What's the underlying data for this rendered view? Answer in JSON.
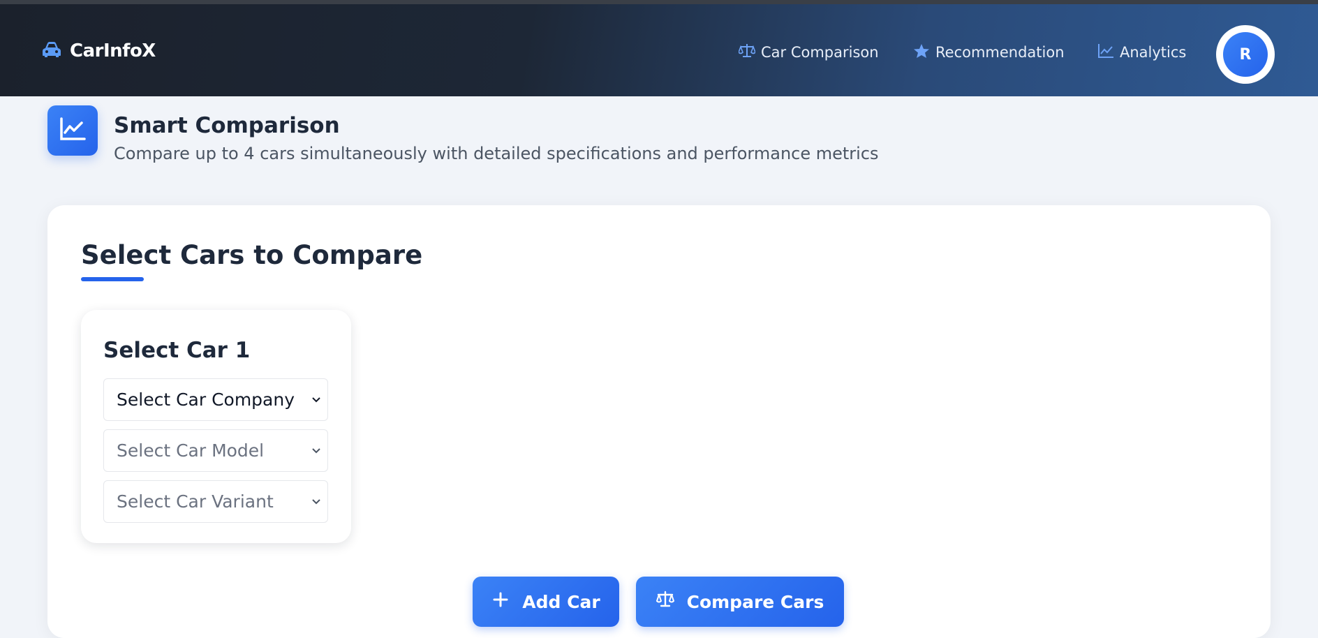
{
  "app": {
    "brand": "CarInfoX",
    "brand_icon": "car-icon"
  },
  "nav": {
    "items": [
      {
        "label": "Car Comparison",
        "icon": "scale-icon"
      },
      {
        "label": "Recommendation",
        "icon": "star-icon"
      },
      {
        "label": "Analytics",
        "icon": "chart-line-icon"
      }
    ],
    "avatar_initial": "R"
  },
  "header": {
    "icon": "chart-line-icon",
    "title": "Smart Comparison",
    "subtitle": "Compare up to 4 cars simultaneously with detailed specifications and performance metrics"
  },
  "main": {
    "title": "Select Cars to Compare",
    "car_slots": [
      {
        "title": "Select Car 1",
        "company_placeholder": "Select Car Company",
        "model_placeholder": "Select Car Model",
        "variant_placeholder": "Select Car Variant"
      }
    ],
    "add_button": "Add Car",
    "compare_button": "Compare Cars"
  },
  "colors": {
    "accent": "#2563eb",
    "accent_light": "#3b82f6",
    "nav_dark": "#1b212c",
    "nav_blue": "#2f5a94"
  }
}
